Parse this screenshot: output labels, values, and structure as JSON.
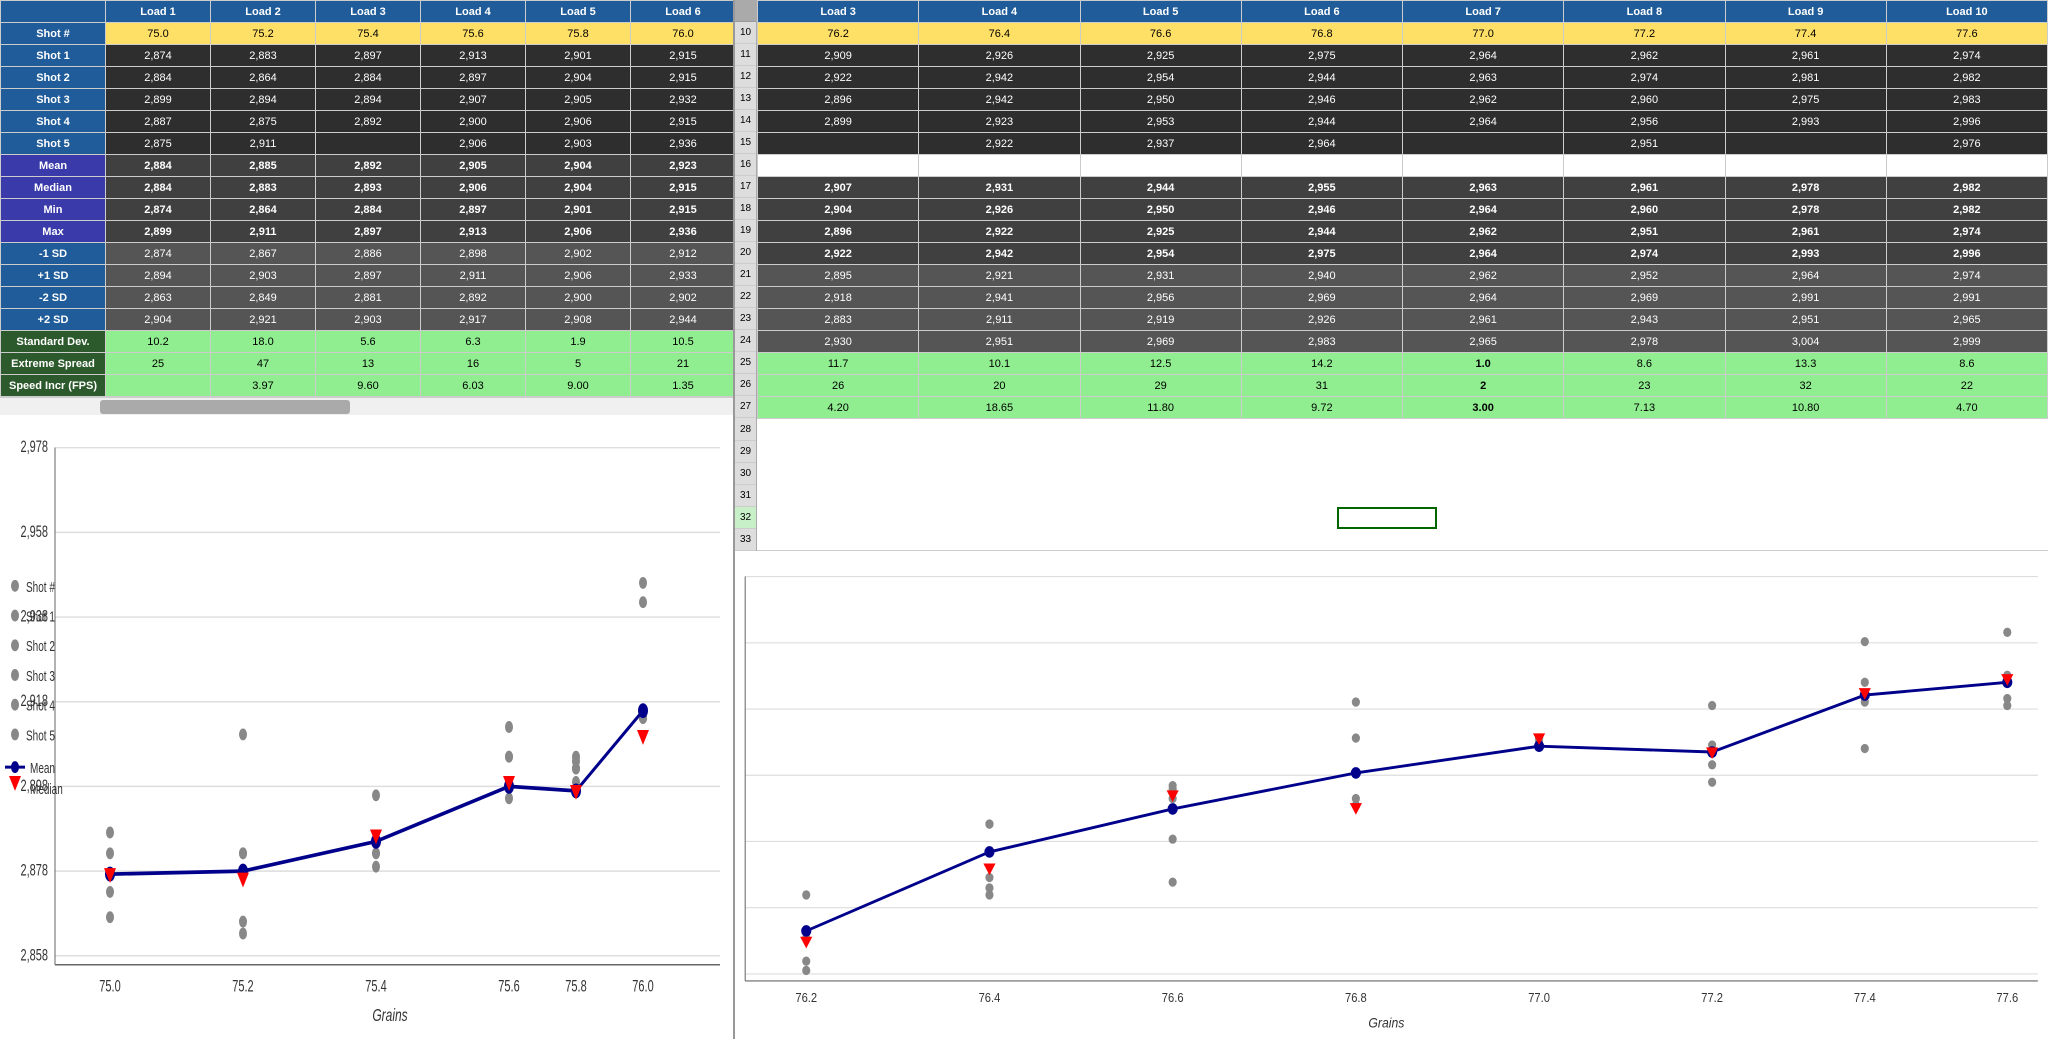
{
  "left_table": {
    "headers": [
      "",
      "Load 1",
      "Load 2",
      "Load 3",
      "Load 4",
      "Load 5",
      "Load 6"
    ],
    "rows": [
      {
        "label": "Shot #",
        "type": "header_shot",
        "values": [
          "75.0",
          "75.2",
          "75.4",
          "75.6",
          "75.8",
          "76.0"
        ],
        "highlight": "yellow"
      },
      {
        "label": "Shot 1",
        "type": "shot",
        "values": [
          "2,874",
          "2,883",
          "2,897",
          "2,913",
          "2,901",
          "2,915"
        ]
      },
      {
        "label": "Shot 2",
        "type": "shot",
        "values": [
          "2,884",
          "2,864",
          "2,884",
          "2,897",
          "2,904",
          "2,915"
        ]
      },
      {
        "label": "Shot 3",
        "type": "shot",
        "values": [
          "2,899",
          "2,894",
          "2,894",
          "2,907",
          "2,905",
          "2,932"
        ]
      },
      {
        "label": "Shot 4",
        "type": "shot",
        "values": [
          "2,887",
          "2,875",
          "2,892",
          "2,900",
          "2,906",
          "2,915"
        ]
      },
      {
        "label": "Shot 5",
        "type": "shot",
        "values": [
          "2,875",
          "2,911",
          "",
          "2,906",
          "2,903",
          "2,936"
        ]
      },
      {
        "label": "Mean",
        "type": "stat",
        "values": [
          "2,884",
          "2,885",
          "2,892",
          "2,905",
          "2,904",
          "2,923"
        ]
      },
      {
        "label": "Median",
        "type": "stat",
        "values": [
          "2,884",
          "2,883",
          "2,893",
          "2,906",
          "2,904",
          "2,915"
        ]
      },
      {
        "label": "Min",
        "type": "stat",
        "values": [
          "2,874",
          "2,864",
          "2,884",
          "2,897",
          "2,901",
          "2,915"
        ]
      },
      {
        "label": "Max",
        "type": "stat",
        "values": [
          "2,899",
          "2,911",
          "2,897",
          "2,913",
          "2,906",
          "2,936"
        ]
      },
      {
        "label": "-1 SD",
        "type": "sd",
        "values": [
          "2,874",
          "2,867",
          "2,886",
          "2,898",
          "2,902",
          "2,912"
        ]
      },
      {
        "label": "+1 SD",
        "type": "sd",
        "values": [
          "2,894",
          "2,903",
          "2,897",
          "2,911",
          "2,906",
          "2,933"
        ]
      },
      {
        "label": "-2 SD",
        "type": "sd",
        "values": [
          "2,863",
          "2,849",
          "2,881",
          "2,892",
          "2,900",
          "2,902"
        ]
      },
      {
        "label": "+2 SD",
        "type": "sd",
        "values": [
          "2,904",
          "2,921",
          "2,903",
          "2,917",
          "2,908",
          "2,944"
        ]
      },
      {
        "label": "Standard Dev.",
        "type": "stddev",
        "values": [
          "10.2",
          "18.0",
          "5.6",
          "6.3",
          "1.9",
          "10.5"
        ],
        "highlight": "green"
      },
      {
        "label": "Extreme Spread",
        "type": "extreme",
        "values": [
          "25",
          "47",
          "13",
          "16",
          "5",
          "21"
        ],
        "highlight": "green"
      },
      {
        "label": "Speed Incr (FPS)",
        "type": "speed",
        "values": [
          "",
          "3.97",
          "9.60",
          "6.03",
          "9.00",
          "1.35"
        ],
        "highlight": "green"
      }
    ]
  },
  "right_table": {
    "headers": [
      "#",
      "Load 3",
      "Load 4",
      "Load 5",
      "Load 6",
      "Load 7",
      "Load 8",
      "Load 9",
      "Load 10"
    ],
    "rows": [
      {
        "row_num": "10",
        "label_type": "header_shot",
        "values": [
          "76.2",
          "76.4",
          "76.6",
          "76.8",
          "77.0",
          "77.2",
          "77.4",
          "77.6"
        ]
      },
      {
        "row_num": "11",
        "label_type": "shot",
        "values": [
          "2,909",
          "2,926",
          "2,925",
          "2,975",
          "2,964",
          "2,962",
          "2,961",
          "2,974"
        ]
      },
      {
        "row_num": "12",
        "label_type": "shot",
        "values": [
          "2,922",
          "2,942",
          "2,954",
          "2,944",
          "2,963",
          "2,974",
          "2,981",
          "2,982"
        ]
      },
      {
        "row_num": "13",
        "label_type": "shot",
        "values": [
          "2,896",
          "2,942",
          "2,950",
          "2,946",
          "2,962",
          "2,960",
          "2,975",
          "2,983"
        ]
      },
      {
        "row_num": "14",
        "label_type": "shot",
        "values": [
          "2,899",
          "2,923",
          "2,953",
          "2,944",
          "2,964",
          "2,956",
          "2,993",
          "2,996"
        ]
      },
      {
        "row_num": "15",
        "label_type": "shot",
        "values": [
          "",
          "2,922",
          "2,937",
          "2,964",
          "",
          "2,951",
          "",
          "2,976"
        ]
      },
      {
        "row_num": "16",
        "label_type": "empty",
        "values": [
          "",
          "",
          "",
          "",
          "",
          "",
          "",
          ""
        ]
      },
      {
        "row_num": "17",
        "label_type": "stat_mean",
        "values": [
          "2,907",
          "2,931",
          "2,944",
          "2,955",
          "2,963",
          "2,961",
          "2,978",
          "2,982"
        ]
      },
      {
        "row_num": "18",
        "label_type": "stat_median",
        "values": [
          "2,904",
          "2,926",
          "2,950",
          "2,946",
          "2,964",
          "2,960",
          "2,978",
          "2,982"
        ]
      },
      {
        "row_num": "19",
        "label_type": "stat_min",
        "values": [
          "2,896",
          "2,922",
          "2,925",
          "2,944",
          "2,962",
          "2,951",
          "2,961",
          "2,974"
        ]
      },
      {
        "row_num": "20",
        "label_type": "stat_max",
        "values": [
          "2,922",
          "2,942",
          "2,954",
          "2,975",
          "2,964",
          "2,974",
          "2,993",
          "2,996"
        ]
      },
      {
        "row_num": "21",
        "label_type": "sd_minus1",
        "values": [
          "2,895",
          "2,921",
          "2,931",
          "2,940",
          "2,962",
          "2,952",
          "2,964",
          "2,974"
        ]
      },
      {
        "row_num": "22",
        "label_type": "sd_plus1",
        "values": [
          "2,918",
          "2,941",
          "2,956",
          "2,969",
          "2,964",
          "2,969",
          "2,991",
          "2,991"
        ]
      },
      {
        "row_num": "23",
        "label_type": "sd_minus2",
        "values": [
          "2,883",
          "2,911",
          "2,919",
          "2,926",
          "2,961",
          "2,943",
          "2,951",
          "2,965"
        ]
      },
      {
        "row_num": "24",
        "label_type": "sd_plus2",
        "values": [
          "2,930",
          "2,951",
          "2,969",
          "2,983",
          "2,965",
          "2,978",
          "3,004",
          "2,999"
        ]
      },
      {
        "row_num": "25",
        "label_type": "stddev",
        "values": [
          "11.7",
          "10.1",
          "12.5",
          "14.2",
          "1.0",
          "8.6",
          "13.3",
          "8.6"
        ]
      },
      {
        "row_num": "26",
        "label_type": "extreme",
        "values": [
          "26",
          "20",
          "29",
          "31",
          "2",
          "23",
          "32",
          "22"
        ]
      },
      {
        "row_num": "27",
        "label_type": "speed",
        "values": [
          "4.20",
          "18.65",
          "11.80",
          "9.72",
          "3.00",
          "7.13",
          "10.80",
          "4.70"
        ]
      }
    ]
  },
  "chart_left": {
    "title": "Grains",
    "y_axis_values": [
      "2,978",
      "2,958",
      "2,938",
      "2,918",
      "2,898",
      "2,878",
      "2,858"
    ],
    "x_axis_values": [
      "75.0",
      "75.2",
      "75.4",
      "75.6",
      "75.8",
      "76.0"
    ],
    "legend": {
      "shot_label": "Shot #",
      "shot1_label": "Shot 1",
      "shot2_label": "Shot 2",
      "shot3_label": "Shot 3",
      "shot4_label": "Shot 4",
      "shot5_label": "Shot 5",
      "mean_label": "Mean",
      "median_label": "Median"
    }
  },
  "chart_right": {
    "title": "Grains",
    "y_axis_values": [],
    "x_axis_values": [
      "76.2",
      "76.4",
      "76.6",
      "76.8",
      "77.0",
      "77.2",
      "77.4",
      "77.6"
    ]
  }
}
